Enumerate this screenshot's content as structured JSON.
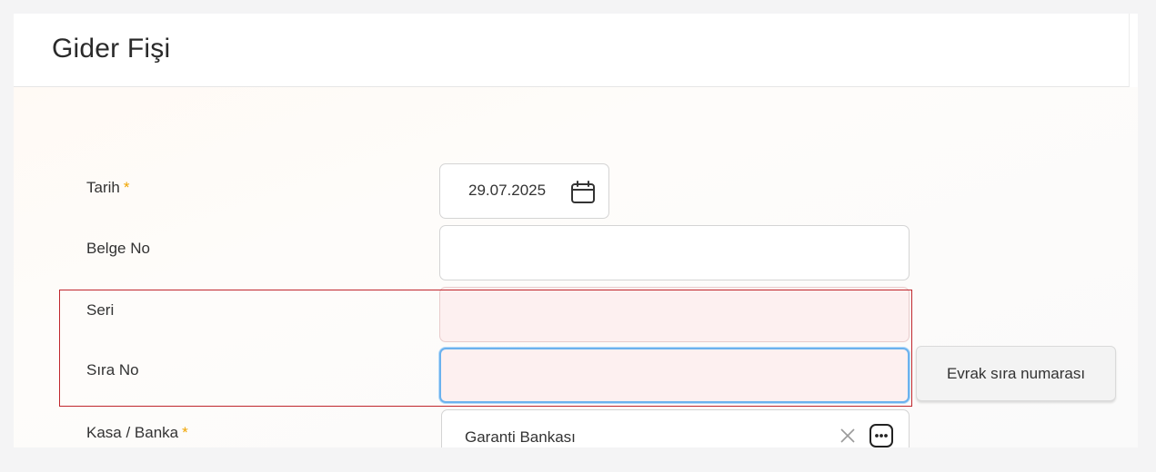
{
  "page": {
    "title": "Gider Fişi"
  },
  "form": {
    "tarih": {
      "label": "Tarih",
      "required_mark": "*",
      "value": "29.07.2025",
      "icon": "calendar-icon"
    },
    "belge_no": {
      "label": "Belge No",
      "value": ""
    },
    "seri": {
      "label": "Seri",
      "value": ""
    },
    "sira_no": {
      "label": "Sıra No",
      "value": ""
    },
    "evrak_button": {
      "label": "Evrak sıra numarası"
    },
    "kasa_banka": {
      "label": "Kasa / Banka",
      "required_mark": "*",
      "value": "Garanti Bankası",
      "clear_icon": "close-icon",
      "more_icon": "ellipsis-icon"
    }
  },
  "colors": {
    "required": "#f0a500",
    "highlight_border": "#c0272d",
    "focus_border": "#6bb2ee",
    "error_field_bg": "#fdf0f0"
  }
}
